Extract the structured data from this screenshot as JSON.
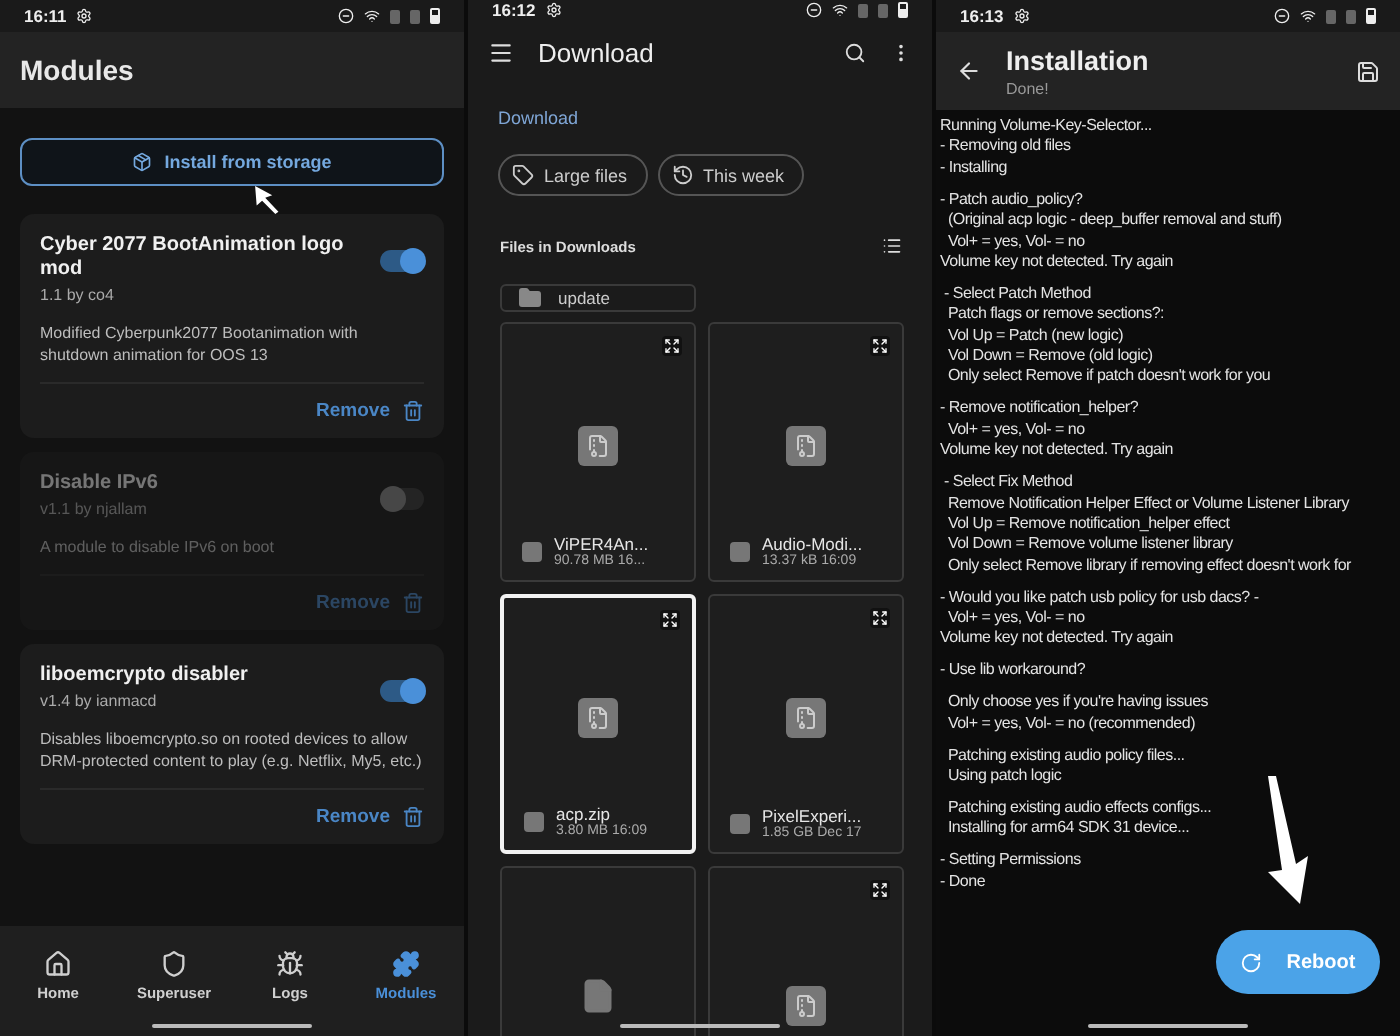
{
  "modules_screen": {
    "status_bar": {
      "time": "16:11"
    },
    "title": "Modules",
    "install_button": "Install from storage",
    "modules": [
      {
        "name": "Cyber 2077 BootAnimation logo mod",
        "version": "1.1 by co4",
        "description": "Modified Cyberpunk2077 Bootanimation with shutdown animation for OOS 13",
        "enabled": true,
        "action": "Remove"
      },
      {
        "name": "Disable IPv6",
        "version": "v1.1 by njallam",
        "description": "A module to disable IPv6 on boot",
        "enabled": false,
        "action": "Remove"
      },
      {
        "name": "liboemcrypto disabler",
        "version": "v1.4 by ianmacd",
        "description": "Disables liboemcrypto.so on rooted devices to allow DRM-protected content to play (e.g. Netflix, My5, etc.)",
        "enabled": true,
        "action": "Remove"
      }
    ],
    "nav": [
      {
        "label": "Home",
        "kind": "home",
        "selected": false
      },
      {
        "label": "Superuser",
        "kind": "shield",
        "selected": false
      },
      {
        "label": "Logs",
        "kind": "bug",
        "selected": false
      },
      {
        "label": "Modules",
        "kind": "puzzle",
        "selected": true
      }
    ]
  },
  "files_screen": {
    "status_bar": {
      "time": "16:12"
    },
    "title": "Download",
    "breadcrumb": "Download",
    "chips": [
      {
        "label": "Large files",
        "kind": "tag"
      },
      {
        "label": "This week",
        "kind": "history"
      }
    ],
    "section_title": "Files in Downloads",
    "folders": [
      {
        "name": "update"
      }
    ],
    "files": [
      {
        "kind": "archive",
        "name": "ViPER4An...",
        "meta": "90.78 MB 16...",
        "selected": false
      },
      {
        "kind": "archive",
        "name": "Audio-Modi...",
        "meta": "13.37 kB 16:09",
        "selected": false
      },
      {
        "kind": "archive",
        "name": "acp.zip",
        "meta": "3.80 MB 16:09",
        "selected": true
      },
      {
        "kind": "archive",
        "name": "PixelExperi...",
        "meta": "1.85 GB Dec 17",
        "selected": false
      },
      {
        "kind": "partial_doc",
        "selected": false
      },
      {
        "kind": "partial_archive",
        "selected": false
      }
    ]
  },
  "install_screen": {
    "status_bar": {
      "time": "16:13"
    },
    "title": "Installation",
    "subtitle": "Done!",
    "log": [
      [
        "Running Volume-Key-Selector...",
        "- Removing old files",
        "- Installing"
      ],
      [
        "- Patch audio_policy?",
        "  (Original acp logic - deep_buffer removal and stuff)",
        "  Vol+ = yes, Vol- = no",
        "Volume key not detected. Try again"
      ],
      [
        " - Select Patch Method",
        "  Patch flags or remove sections?:",
        "  Vol Up = Patch (new logic)",
        "  Vol Down = Remove (old logic)",
        "  Only select Remove if patch doesn't work for you"
      ],
      [
        "- Remove notification_helper?",
        "  Vol+ = yes, Vol- = no",
        "Volume key not detected. Try again"
      ],
      [
        " - Select Fix Method",
        "  Remove Notification Helper Effect or Volume Listener Library",
        "  Vol Up = Remove notification_helper effect",
        "  Vol Down = Remove volume listener library",
        "  Only select Remove library if removing effect doesn't work for"
      ],
      [
        "- Would you like patch usb policy for usb dacs? -",
        "  Vol+ = yes, Vol- = no",
        "Volume key not detected. Try again"
      ],
      [
        "- Use lib workaround?"
      ],
      [
        "  Only choose yes if you're having issues",
        "  Vol+ = yes, Vol- = no (recommended)"
      ],
      [
        "  Patching existing audio policy files...",
        "  Using patch logic"
      ],
      [
        "  Patching existing audio effects configs...",
        "  Installing for arm64 SDK 31 device..."
      ],
      [
        "- Setting Permissions",
        "- Done"
      ]
    ],
    "fab": "Reboot"
  }
}
